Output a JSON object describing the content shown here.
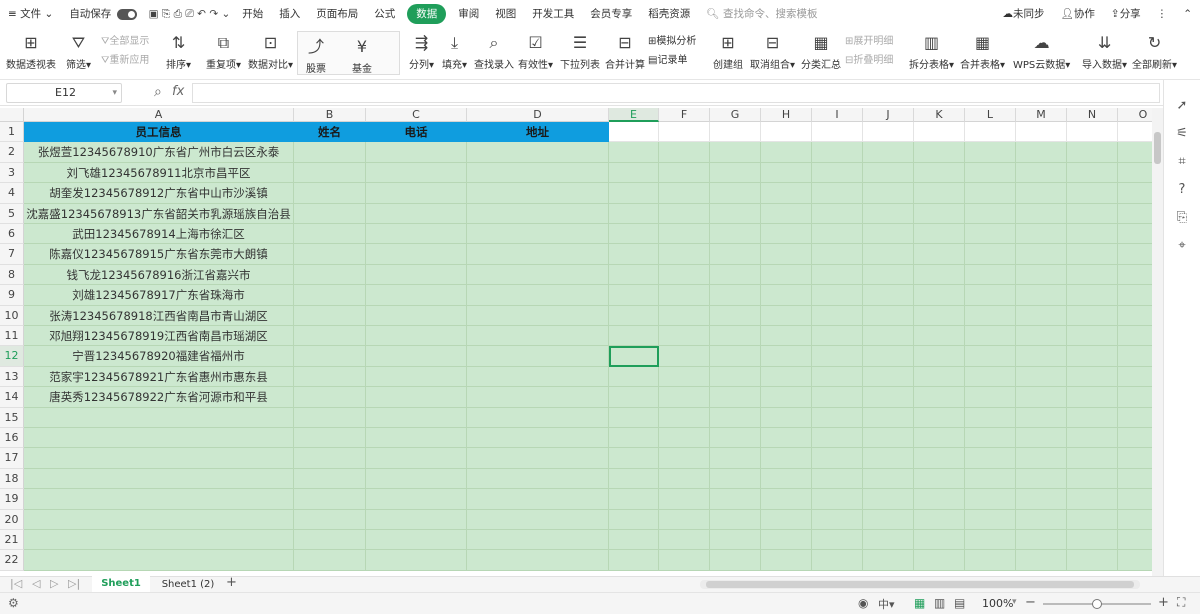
{
  "menubar": {
    "hamburger_icon": "≡",
    "file_label": "文件",
    "autosave_label": "自动保存",
    "tabs": [
      "开始",
      "插入",
      "页面布局",
      "公式",
      "数据",
      "审阅",
      "视图",
      "开发工具",
      "会员专享",
      "稻壳资源"
    ],
    "active_tab": "数据",
    "search_placeholder": "查找命令、搜索模板",
    "sync_label": "未同步",
    "collab_label": "协作",
    "share_label": "分享"
  },
  "ribbon": {
    "pivot": "数据透视表",
    "filter": "筛选",
    "show_all": "全部显示",
    "reapply": "重新应用",
    "sort": "排序",
    "dup": "重复项",
    "compare": "数据对比",
    "stock": "股票",
    "fund": "基金",
    "split": "分列",
    "fill": "填充",
    "lookup": "查找录入",
    "validity": "有效性",
    "dropdown": "下拉列表",
    "merge_calc": "合并计算",
    "simulate": "模拟分析",
    "record": "记录单",
    "group": "创建组",
    "ungroup": "取消组合",
    "subtotal": "分类汇总",
    "expand": "展开明细",
    "collapse": "折叠明细",
    "split_table": "拆分表格",
    "merge_table": "合并表格",
    "cloud": "WPS云数据",
    "import": "导入数据",
    "refresh_all": "全部刷新"
  },
  "formula_bar": {
    "name_box": "E12",
    "fx_label": "fx",
    "formula": ""
  },
  "sheet": {
    "columns": [
      "A",
      "B",
      "C",
      "D",
      "E",
      "F",
      "G",
      "H",
      "I",
      "J",
      "K",
      "L",
      "M",
      "N",
      "O"
    ],
    "active_column": "E",
    "active_row": "12",
    "row_numbers": [
      "1",
      "2",
      "3",
      "4",
      "5",
      "6",
      "7",
      "8",
      "9",
      "10",
      "11",
      "12",
      "13",
      "14",
      "15",
      "16",
      "17",
      "18",
      "19",
      "20",
      "21",
      "22"
    ],
    "header_row": [
      "员工信息",
      "姓名",
      "电话",
      "地址"
    ],
    "records": [
      "张煜萱12345678910广东省广州市白云区永泰",
      "刘飞雄12345678911北京市昌平区",
      "胡奎发12345678912广东省中山市沙溪镇",
      "沈嘉盛12345678913广东省韶关市乳源瑶族自治县",
      "武田12345678914上海市徐汇区",
      "陈嘉仪12345678915广东省东莞市大朗镇",
      "钱飞龙12345678916浙江省嘉兴市",
      "刘雄12345678917广东省珠海市",
      "张涛12345678918江西省南昌市青山湖区",
      "邓旭翔12345678919江西省南昌市瑶湖区",
      "宁晋12345678920福建省福州市",
      "范家宇12345678921广东省惠州市惠东县",
      "唐英秀12345678922广东省河源市和平县"
    ]
  },
  "tabs": {
    "sheets": [
      "Sheet1",
      "Sheet1 (2)"
    ],
    "active": "Sheet1",
    "add": "+"
  },
  "status": {
    "zoom": "100%",
    "zoom_level": 0.5
  },
  "colors": {
    "header_fill": "#0f9ddf",
    "cell_fill": "#cce8cf",
    "accent": "#1f9e5a"
  }
}
